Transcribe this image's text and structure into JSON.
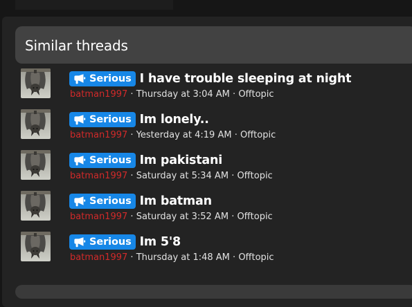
{
  "section": {
    "title": "Similar threads"
  },
  "threads": [
    {
      "prefix": "Serious",
      "title": "I have trouble sleeping at night",
      "author": "batman1997",
      "date": "Thursday at 3:04 AM",
      "forum": "Offtopic"
    },
    {
      "prefix": "Serious",
      "title": "Im lonely..",
      "author": "batman1997",
      "date": "Yesterday at 4:19 AM",
      "forum": "Offtopic"
    },
    {
      "prefix": "Serious",
      "title": "Im pakistani",
      "author": "batman1997",
      "date": "Saturday at 5:34 AM",
      "forum": "Offtopic"
    },
    {
      "prefix": "Serious",
      "title": "Im batman",
      "author": "batman1997",
      "date": "Saturday at 3:52 AM",
      "forum": "Offtopic"
    },
    {
      "prefix": "Serious",
      "title": "Im 5'8",
      "author": "batman1997",
      "date": "Thursday at 1:48 AM",
      "forum": "Offtopic"
    }
  ],
  "colors": {
    "prefix_bg": "#1787e7",
    "author": "#d12a2a",
    "header_bg": "#424242",
    "panel_bg": "#232323"
  },
  "icons": {
    "prefix": "megaphone-icon",
    "avatar": "bat-avatar"
  },
  "meta_separator": "·"
}
